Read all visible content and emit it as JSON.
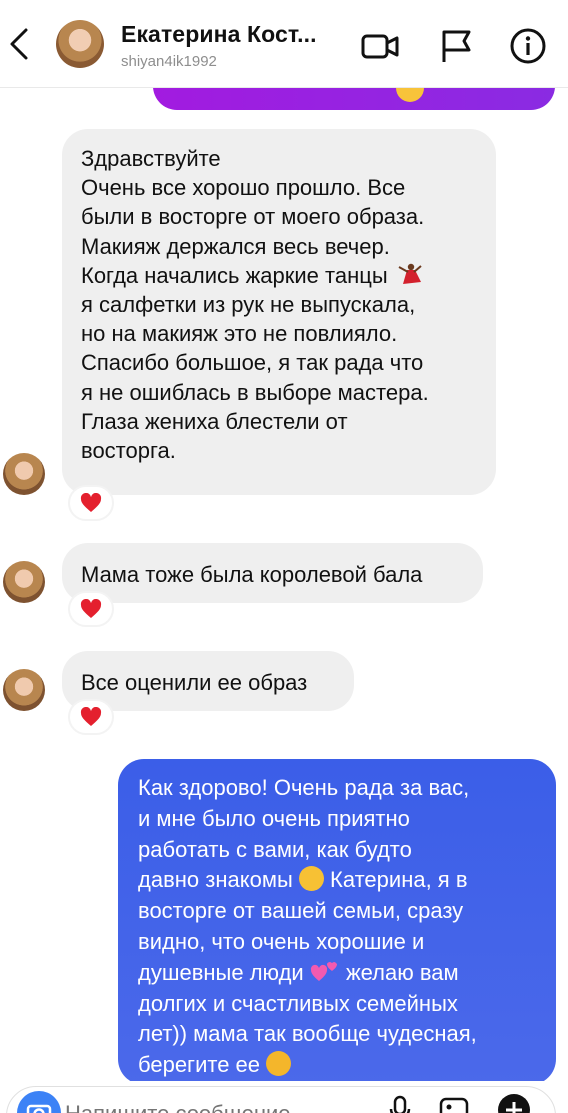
{
  "header": {
    "name": "Екатерина Кост...",
    "username": "shiyan4ik1992"
  },
  "messages": {
    "m1": {
      "lines": [
        "Здравствуйте",
        "Очень все хорошо прошло. Все",
        "были в восторге от моего образа.",
        "Макияж держался весь вечер.",
        "Когда начались жаркие танцы",
        "я салфетки из рук не выпускала,",
        "но на макияж это не повлияло.",
        "Спасибо большое, я так рада что",
        "я не ошиблась в выборе мастера.",
        "Глаза жениха блестели от",
        "восторга."
      ],
      "reaction": "heart"
    },
    "m2": {
      "text": "Мама тоже была королевой бала",
      "reaction": "heart"
    },
    "m3": {
      "text": "Все оценили ее образ",
      "reaction": "heart"
    },
    "m4": {
      "lines": [
        "Как  здорово! Очень рада за вас,",
        "и мне было очень приятно",
        "работать с вами,  как  будто",
        "давно знакомы",
        "Катерина,  я в",
        "восторге от вашей семьи,  сразу",
        "видно,  что очень хорошие и",
        "душевные люди",
        "желаю вам",
        "долгих и счастливых семейных",
        "лет))  мама так вообще чудесная,",
        "берегите ее"
      ]
    }
  },
  "composer": {
    "placeholder": "Напишите сообщение..."
  },
  "icons": {
    "back": "chevron-left-icon",
    "video": "video-camera-icon",
    "flag": "flag-icon",
    "info": "info-icon",
    "camera": "camera-icon",
    "mic": "microphone-icon",
    "gallery": "image-icon",
    "add": "plus-circle-icon"
  },
  "colors": {
    "sent_bubble": "#4466e8",
    "received_bubble": "#efefef",
    "top_bubble": "#9b22e0",
    "reaction_heart": "#e4202e"
  }
}
